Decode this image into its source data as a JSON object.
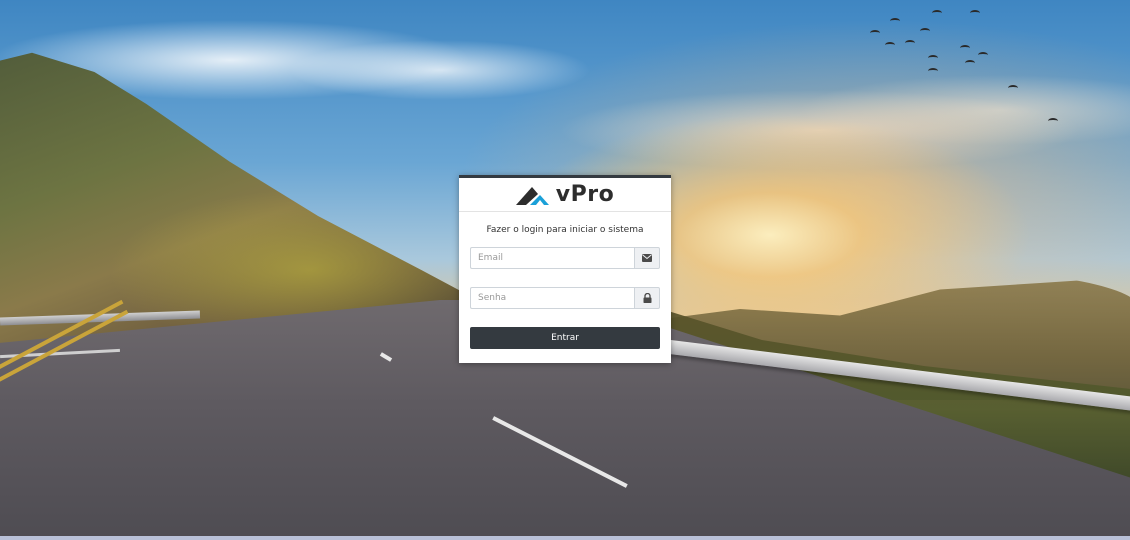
{
  "brand": {
    "name": "vPro",
    "accent_color": "#1aa0d8",
    "dark_color": "#2d2d2d"
  },
  "login": {
    "message": "Fazer o login para iniciar o sistema",
    "email": {
      "placeholder": "Email",
      "icon": "envelope-icon"
    },
    "password": {
      "placeholder": "Senha",
      "icon": "lock-icon"
    },
    "submit_label": "Entrar"
  },
  "theme": {
    "button_color": "#343a40"
  }
}
